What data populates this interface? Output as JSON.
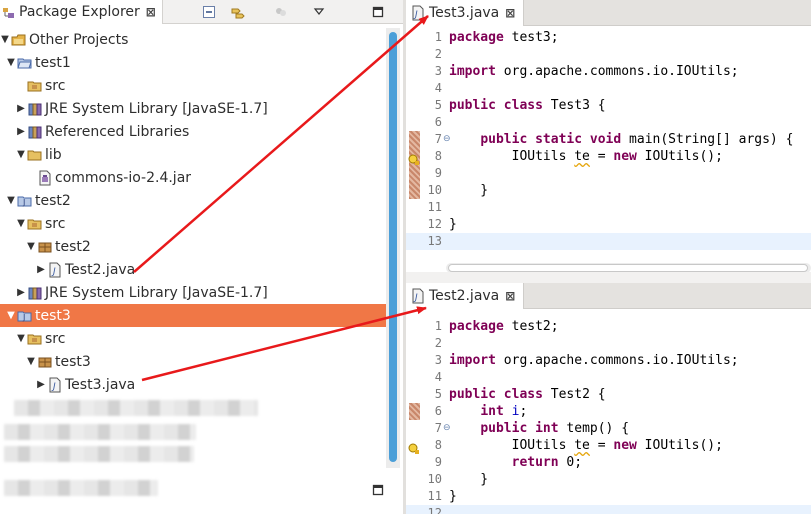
{
  "explorer": {
    "tab_label": "Package Explorer",
    "close_glyph": "⊠",
    "toolbar": {
      "collapse_icon": "collapse-all-icon",
      "link_icon": "link-with-editor-icon",
      "menu_icon": "view-menu-icon",
      "minimize_icon": "minimize-icon"
    },
    "tree": [
      {
        "label": "Other Projects",
        "twisty": "▼",
        "icon": "working-set-icon"
      },
      {
        "label": "test1",
        "twisty": "▼",
        "icon": "project-folder-icon"
      },
      {
        "label": "src",
        "twisty": "",
        "icon": "source-folder-icon"
      },
      {
        "label": "JRE System Library [JavaSE-1.7]",
        "twisty": "▶",
        "icon": "library-icon"
      },
      {
        "label": "Referenced Libraries",
        "twisty": "▶",
        "icon": "library-icon"
      },
      {
        "label": "lib",
        "twisty": "▼",
        "icon": "folder-icon"
      },
      {
        "label": "commons-io-2.4.jar",
        "twisty": "",
        "icon": "jar-file-icon"
      },
      {
        "label": "test2",
        "twisty": "▼",
        "icon": "java-project-icon"
      },
      {
        "label": "src",
        "twisty": "▼",
        "icon": "source-folder-icon"
      },
      {
        "label": "test2",
        "twisty": "▼",
        "icon": "package-icon"
      },
      {
        "label": "Test2.java",
        "twisty": "▶",
        "icon": "java-file-icon"
      },
      {
        "label": "JRE System Library [JavaSE-1.7]",
        "twisty": "▶",
        "icon": "library-icon"
      },
      {
        "label": "test3",
        "twisty": "▼",
        "icon": "java-project-icon"
      },
      {
        "label": "src",
        "twisty": "▼",
        "icon": "source-folder-icon"
      },
      {
        "label": "test3",
        "twisty": "▼",
        "icon": "package-icon"
      },
      {
        "label": "Test3.java",
        "twisty": "▶",
        "icon": "java-file-icon"
      }
    ]
  },
  "editors": {
    "top": {
      "tab_label": "Test3.java",
      "close_glyph": "⊠",
      "lines": [
        {
          "n": "1",
          "text": "package test3;"
        },
        {
          "n": "2",
          "text": ""
        },
        {
          "n": "3",
          "text": "import org.apache.commons.io.IOUtils;"
        },
        {
          "n": "4",
          "text": ""
        },
        {
          "n": "5",
          "text": "public class Test3 {"
        },
        {
          "n": "6",
          "text": ""
        },
        {
          "n": "7",
          "text": "    public static void main(String[] args) {"
        },
        {
          "n": "8",
          "text": "        IOUtils te = new IOUtils();"
        },
        {
          "n": "9",
          "text": ""
        },
        {
          "n": "10",
          "text": "    }"
        },
        {
          "n": "11",
          "text": ""
        },
        {
          "n": "12",
          "text": "}"
        },
        {
          "n": "13",
          "text": ""
        }
      ]
    },
    "bottom": {
      "tab_label": "Test2.java",
      "close_glyph": "⊠",
      "lines": [
        {
          "n": "1",
          "text": "package test2;"
        },
        {
          "n": "2",
          "text": ""
        },
        {
          "n": "3",
          "text": "import org.apache.commons.io.IOUtils;"
        },
        {
          "n": "4",
          "text": ""
        },
        {
          "n": "5",
          "text": "public class Test2 {"
        },
        {
          "n": "6",
          "text": "    int i;"
        },
        {
          "n": "7",
          "text": "    public int temp() {"
        },
        {
          "n": "8",
          "text": "        IOUtils te = new IOUtils();"
        },
        {
          "n": "9",
          "text": "        return 0;"
        },
        {
          "n": "10",
          "text": "    }"
        },
        {
          "n": "11",
          "text": "}"
        },
        {
          "n": "12",
          "text": ""
        }
      ]
    }
  },
  "colors": {
    "selection": "#f07746",
    "keyword": "#7f0055",
    "field": "#0000c0",
    "arrow": "#e8191b",
    "scrollbar": "#4b9fd8"
  }
}
